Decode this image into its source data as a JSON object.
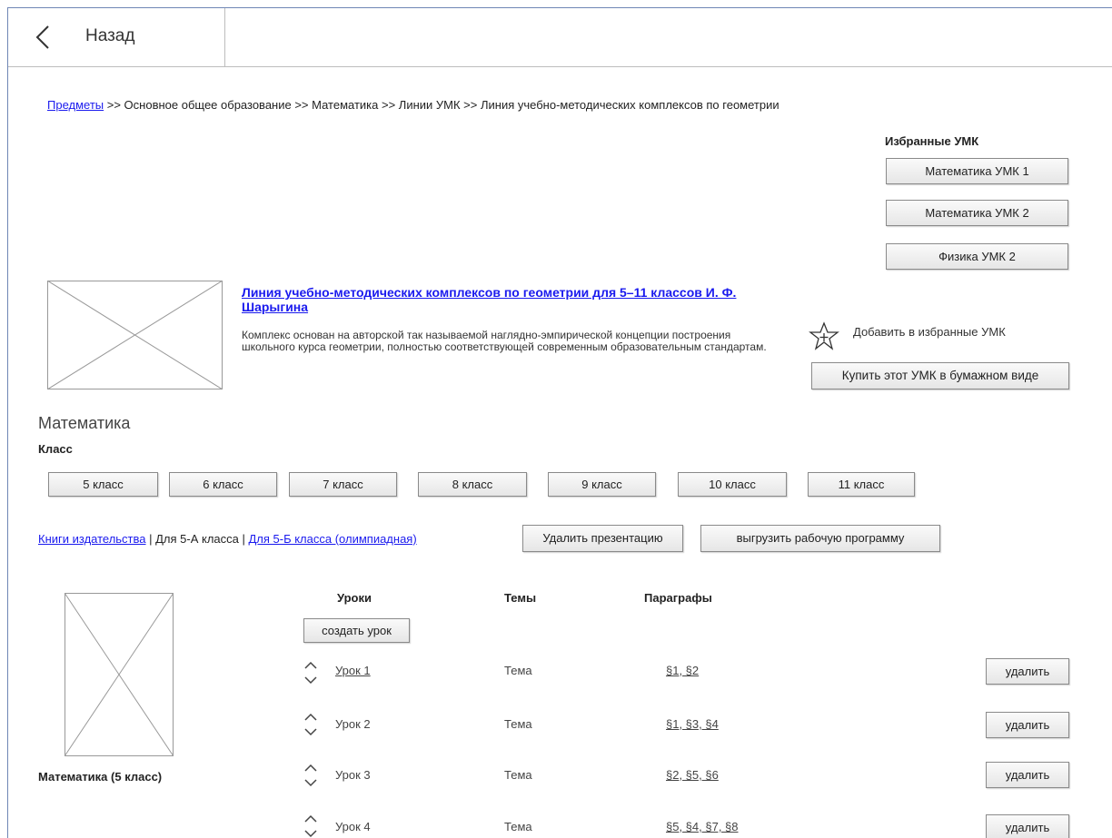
{
  "nav": {
    "back_label": "Назад"
  },
  "breadcrumb": {
    "link": "Предметы",
    "rest": " >> Основное общее образование >> Математика >> Линии УМК >> Линия учебно-методических комплексов по геометрии"
  },
  "favorites": {
    "title": "Избранные УМК",
    "items": [
      "Математика УМК 1",
      "Математика УМК 2",
      "Физика УМК 2"
    ]
  },
  "line": {
    "title": "Линия учебно-методических комплексов по геометрии для 5–11 классов И. Ф. Шарыгина",
    "description": "Комплекс основан на авторской так называемой наглядно-эмпирической концепции построения школьного курса геометрии, полностью соответствующей современным образовательным стандартам.",
    "add_favorite": "Добавить в избранные УМК",
    "buy_paper": "Купить этот УМК в бумажном виде"
  },
  "subject": {
    "title": "Математика",
    "class_label": "Класс",
    "classes": [
      "5 класс",
      "6 класс",
      "7 класс",
      "8 класс",
      "9 класс",
      "10 класс",
      "11 класс"
    ]
  },
  "books": {
    "link1": "Книги издательства",
    "sep1": " | Для 5-А класса | ",
    "link2": "Для 5-Б класса (олимпиадная)",
    "delete_presentation": "Удалить презентацию",
    "export_program": "выгрузить рабочую программу"
  },
  "lessons": {
    "book_caption": "Математика (5 класс)",
    "col_lessons": "Уроки",
    "col_topics": "Темы",
    "col_paragraphs": "Параграфы",
    "create": "создать урок",
    "delete_label": "удалить",
    "rows": [
      {
        "lesson": "Урок 1",
        "topic": "Тема",
        "paragraphs": "§1, §2"
      },
      {
        "lesson": "Урок 2",
        "topic": "Тема",
        "paragraphs": "§1, §3, §4"
      },
      {
        "lesson": "Урок 3",
        "topic": "Тема",
        "paragraphs": "§2, §5, §6"
      },
      {
        "lesson": "Урок 4",
        "topic": "Тема",
        "paragraphs": "§5, §4, §7, §8"
      }
    ]
  }
}
